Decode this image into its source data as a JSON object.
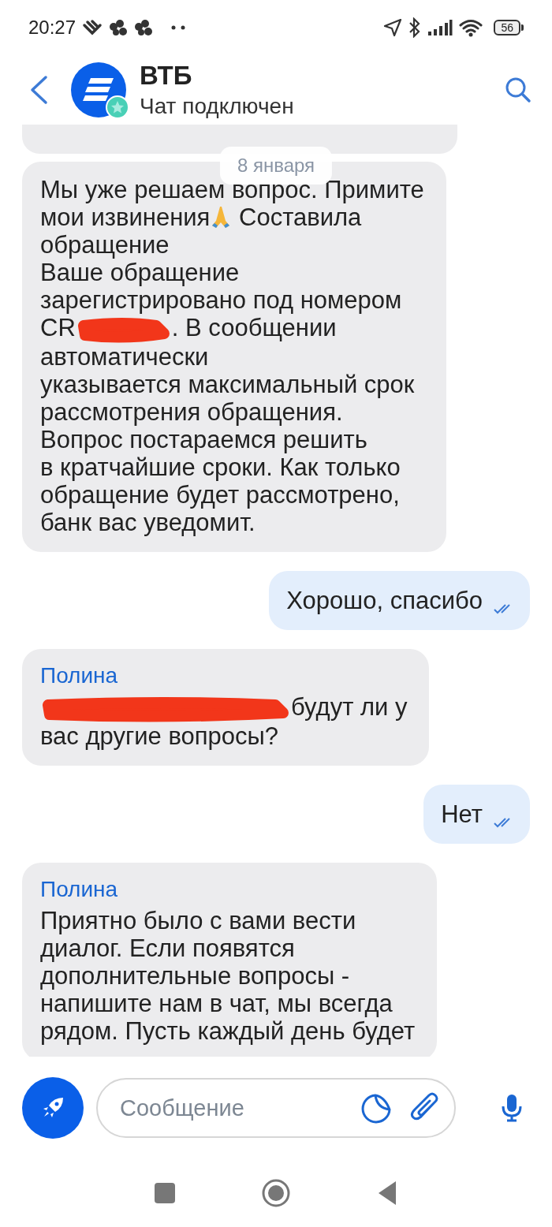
{
  "status_bar": {
    "time": "20:27",
    "battery": "56"
  },
  "header": {
    "title": "ВТБ",
    "subtitle": "Чат подключен"
  },
  "date_chip": "8 января",
  "messages": [
    {
      "kind": "fragment"
    },
    {
      "kind": "incoming",
      "lines": [
        [
          "Мы уже решаем вопрос. Примите"
        ],
        [
          "мои извинения",
          {
            "kind": "emoji"
          },
          " Составила"
        ],
        [
          "обращение"
        ],
        [
          "Ваше обращение"
        ],
        [
          "зарегистрировано под номером"
        ],
        [
          "CR",
          {
            "kind": "redaction"
          },
          ". В сообщении"
        ],
        [
          "автоматически"
        ],
        [
          "указывается максимальный срок"
        ],
        [
          "рассмотрения обращения."
        ],
        [
          "Вопрос постараемся решить"
        ],
        [
          "в кратчайшие сроки. Как только"
        ],
        [
          "обращение будет рассмотрено,"
        ],
        [
          "банк вас уведомит."
        ]
      ]
    },
    {
      "kind": "outgoing",
      "lines": [
        [
          "Хорошо, спасибо"
        ]
      ],
      "read": true
    },
    {
      "kind": "incoming",
      "sender": "Полина",
      "lines": [
        [
          {
            "kind": "longredaction"
          },
          "будут ли у"
        ],
        [
          "вас другие вопросы?"
        ]
      ]
    },
    {
      "kind": "outgoing",
      "lines": [
        [
          "Нет"
        ]
      ],
      "read": true
    },
    {
      "kind": "incoming",
      "sender": "Полина",
      "lines": [
        [
          "Приятно было с вами вести"
        ],
        [
          "диалог. Если появятся"
        ],
        [
          "дополнительные вопросы -"
        ],
        [
          "напишите нам в чат, мы всегда"
        ],
        [
          "рядом. Пусть каждый день будет"
        ]
      ]
    }
  ],
  "composer": {
    "placeholder": "Сообщение"
  }
}
